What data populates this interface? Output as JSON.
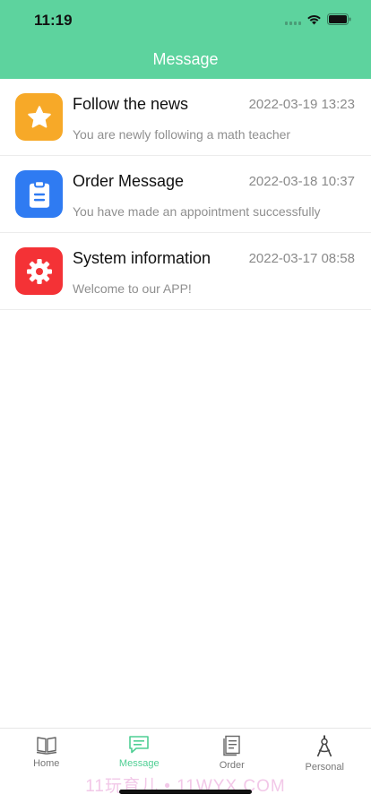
{
  "status": {
    "time": "11:19"
  },
  "header": {
    "title": "Message"
  },
  "messages": [
    {
      "name": "Follow the news",
      "time": "2022-03-19 13:23",
      "preview": "You are newly following a math teacher",
      "icon": "star-icon",
      "color": "#f7a928"
    },
    {
      "name": "Order Message",
      "time": "2022-03-18 10:37",
      "preview": "You have made an appointment successfully",
      "icon": "clipboard-icon",
      "color": "#2f7bf2"
    },
    {
      "name": "System information",
      "time": "2022-03-17 08:58",
      "preview": "Welcome to our APP!",
      "icon": "gear-icon",
      "color": "#f43236"
    }
  ],
  "tabs": [
    {
      "label": "Home",
      "icon": "book-icon",
      "active": false
    },
    {
      "label": "Message",
      "icon": "chat-icon",
      "active": true
    },
    {
      "label": "Order",
      "icon": "document-icon",
      "active": false
    },
    {
      "label": "Personal",
      "icon": "compass-icon",
      "active": false
    }
  ],
  "watermark": "11玩育儿 • 11WYX.COM",
  "colors": {
    "header": "#5dd39e",
    "active_tab": "#4fcf94",
    "inactive_tab": "#777777"
  }
}
